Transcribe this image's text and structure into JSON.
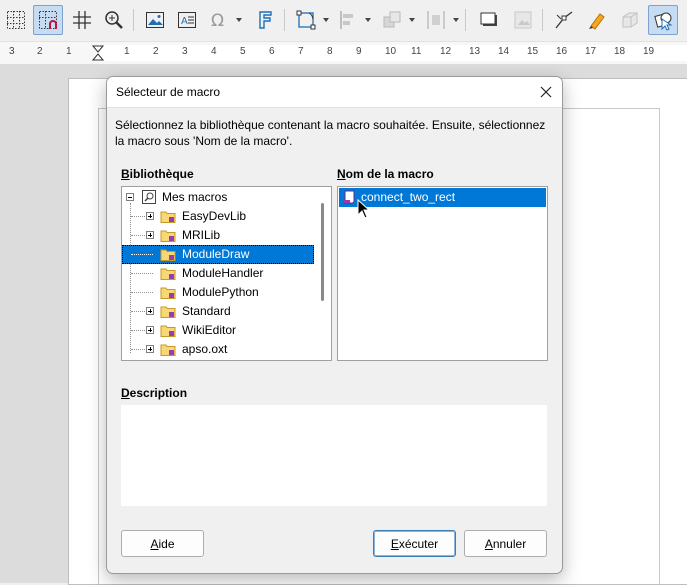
{
  "toolbar": {
    "icons": [
      "grid-display",
      "snap-to-grid",
      "helplines",
      "zoom-pan",
      "insert-image",
      "insert-textbox",
      "insert-special-character",
      "insert-fontwork",
      "transformations",
      "align-objects",
      "arrange",
      "distribute",
      "shadow",
      "crop",
      "points",
      "glue-points",
      "toggle-3d",
      "select"
    ]
  },
  "ruler": {
    "numbers": [
      "3",
      "2",
      "1",
      "1",
      "2",
      "3",
      "4",
      "5",
      "6",
      "7",
      "8",
      "9",
      "10",
      "11",
      "12",
      "13",
      "14",
      "15",
      "16",
      "17",
      "18",
      "19"
    ]
  },
  "dialog": {
    "title": "Sélecteur de macro",
    "intro": "Sélectionnez la bibliothèque contenant la macro souhaitée. Ensuite, sélectionnez la macro sous 'Nom de la macro'.",
    "library_label_first": "B",
    "library_label_rest": "ibliothèque",
    "macro_label_first": "N",
    "macro_label_rest": "om de la macro",
    "description_label_first": "D",
    "description_label_rest": "escription",
    "description_text": "",
    "tree": {
      "root": "Mes macros",
      "items": [
        {
          "label": "EasyDevLib",
          "expandable": true
        },
        {
          "label": "MRILib",
          "expandable": true
        },
        {
          "label": "ModuleDraw",
          "expandable": false,
          "selected": true
        },
        {
          "label": "ModuleHandler",
          "expandable": false
        },
        {
          "label": "ModulePython",
          "expandable": false
        },
        {
          "label": "Standard",
          "expandable": true
        },
        {
          "label": "WikiEditor",
          "expandable": true
        },
        {
          "label": "apso.oxt",
          "expandable": true
        }
      ]
    },
    "macros": [
      {
        "label": "connect_two_rect",
        "selected": true
      }
    ],
    "buttons": {
      "help_first": "A",
      "help_rest": "ide",
      "run_first": "E",
      "run_rest": "xécuter",
      "cancel_first": "A",
      "cancel_rest": "nnuler"
    }
  },
  "colors": {
    "selection": "#0078d7",
    "dialog_bg": "#f0f0f0",
    "toolbar_active": "#c5dcf3"
  }
}
